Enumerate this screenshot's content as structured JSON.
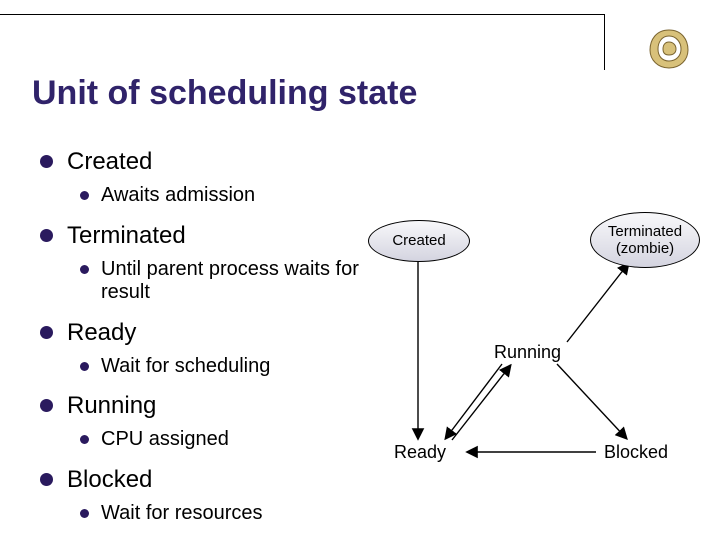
{
  "title": "Unit of scheduling state",
  "bullets": [
    {
      "label": "Created",
      "sub": "Awaits admission"
    },
    {
      "label": "Terminated",
      "sub": "Until parent process waits for result"
    },
    {
      "label": "Ready",
      "sub": "Wait for scheduling"
    },
    {
      "label": "Running",
      "sub": "CPU assigned"
    },
    {
      "label": "Blocked",
      "sub": "Wait for resources"
    }
  ],
  "diagram": {
    "created": "Created",
    "terminated_line1": "Terminated",
    "terminated_line2": "(zombie)",
    "running": "Running",
    "ready": "Ready",
    "blocked": "Blocked"
  }
}
